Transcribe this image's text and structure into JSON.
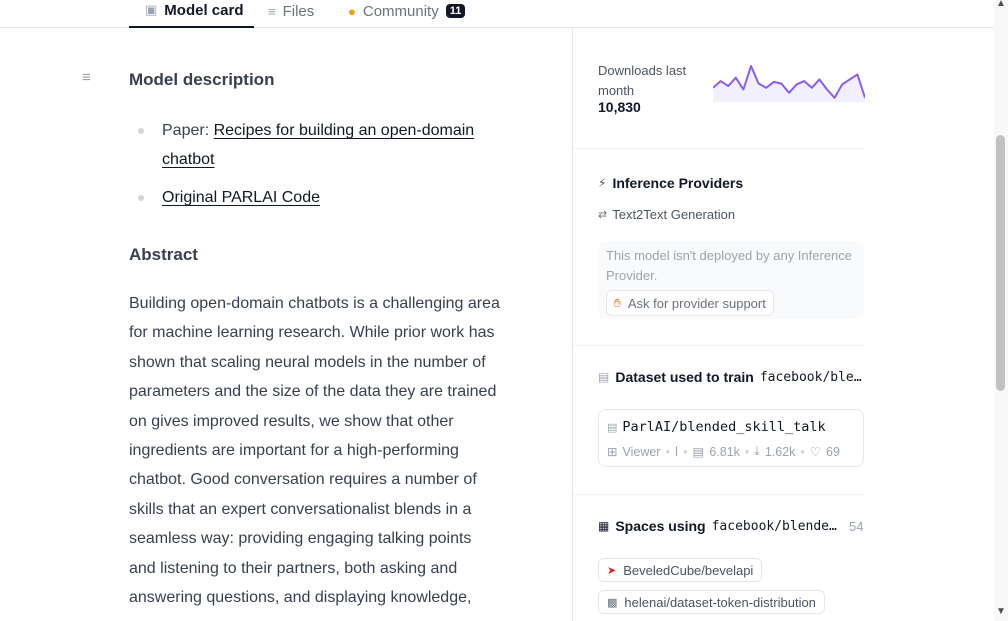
{
  "tabs": [
    {
      "label": "Model card",
      "icon": "cube-icon",
      "active": true
    },
    {
      "label": "Files",
      "icon": "files-icon",
      "active": false
    },
    {
      "label": "Community",
      "icon": "community-icon",
      "active": false,
      "count": "11"
    }
  ],
  "doc": {
    "model_description_heading": "Model description",
    "links": [
      {
        "prefix": "Paper: ",
        "link_text": "Recipes for building an open-domain chatbot"
      },
      {
        "prefix": "",
        "link_text": "Original PARLAI Code"
      }
    ],
    "abstract_heading": "Abstract",
    "abstract_text": "Building open-domain chatbots is a challenging area for machine learning research. While prior work has shown that scaling neural models in the number of parameters and the size of the data they are trained on gives improved results, we show that other ingredients are important for a high-performing chatbot. Good conversation requires a number of skills that an expert conversationalist blends in a seamless way: providing engaging talking points and listening to their partners, both asking and answering questions, and displaying knowledge,"
  },
  "sidebar": {
    "downloads": {
      "label": "Downloads last month",
      "value": "10,830",
      "sparkline": [
        38,
        30,
        36,
        26,
        40,
        12,
        33,
        38,
        31,
        33,
        44,
        34,
        30,
        38,
        28,
        40,
        50,
        34,
        28,
        22,
        50
      ],
      "color": "#8b5cf6"
    },
    "inference": {
      "title": "Inference Providers",
      "task": "Text2Text Generation",
      "notice": "This model isn't deployed by any Inference Provider.",
      "button": "Ask for provider support"
    },
    "dataset": {
      "title_prefix": "Dataset used to train",
      "title_model": "facebook/ble…",
      "name": "ParlAI/blended_skill_talk",
      "viewer": "Viewer",
      "rows": "6.81k",
      "downloads": "1.62k",
      "likes": "69"
    },
    "spaces": {
      "title_prefix": "Spaces using",
      "title_model": "facebook/blende…",
      "count": "54",
      "items": [
        {
          "name": "BeveledCube/bevelapi"
        },
        {
          "name": "helenai/dataset-token-distribution"
        }
      ]
    }
  }
}
